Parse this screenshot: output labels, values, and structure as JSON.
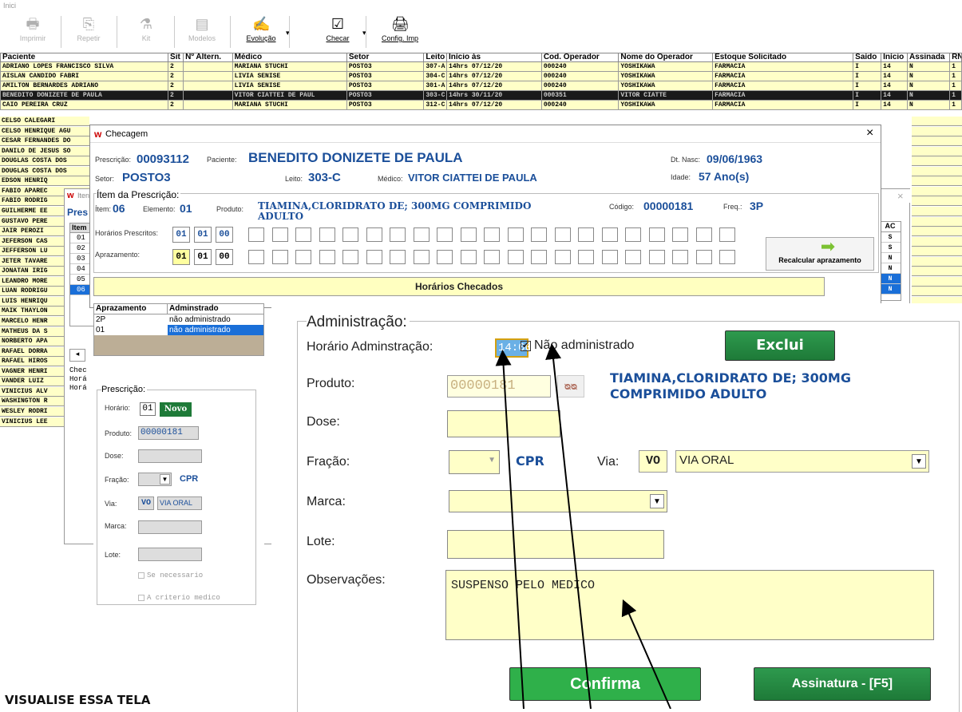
{
  "window_title": "Inici",
  "toolbar": {
    "items": [
      {
        "label": "Imprimir",
        "icon": "printer-icon",
        "enabled": false
      },
      {
        "label": "Repetir",
        "icon": "repeat-icon",
        "enabled": false
      },
      {
        "label": "Kit",
        "icon": "kit-icon",
        "enabled": false
      },
      {
        "label": "Modelos",
        "icon": "models-icon",
        "enabled": false
      },
      {
        "label": "Evolução",
        "icon": "evolution-icon",
        "enabled": true
      },
      {
        "label": "Checar",
        "icon": "check-icon",
        "enabled": true
      },
      {
        "label": "Config. Imp",
        "icon": "printer-config-icon",
        "enabled": true
      }
    ]
  },
  "grid": {
    "headers": [
      "Paciente",
      "Sit",
      "Nº Altern.",
      "Médico",
      "Setor",
      "Leito",
      "Início às",
      "Cod. Operador",
      "Nome do Operador",
      "Estoque Solicitado",
      "Saído",
      "Início",
      "Assinada",
      "RN"
    ],
    "rows": [
      [
        "ADRIANO LOPES FRANCISCO SILVA",
        "2",
        "",
        "MARIANA STUCHI",
        "POSTO3",
        "307-A",
        "14hrs 07/12/20",
        "000240",
        "YOSHIKAWA",
        "FARMACIA",
        "I",
        "14",
        "N",
        "1"
      ],
      [
        "AISLAN CANDIDO FABRI",
        "2",
        "",
        "LIVIA SENISE",
        "POSTO3",
        "304-C",
        "14hrs 07/12/20",
        "000240",
        "YOSHIKAWA",
        "FARMACIA",
        "I",
        "14",
        "N",
        "1"
      ],
      [
        "AMILTON BERNARDES ADRIANO",
        "2",
        "",
        "LIVIA SENISE",
        "POSTO3",
        "301-A",
        "14hrs 07/12/20",
        "000240",
        "YOSHIKAWA",
        "FARMACIA",
        "I",
        "14",
        "N",
        "1"
      ],
      [
        "BENEDITO DONIZETE DE PAULA",
        "2",
        "",
        "VITOR CIATTEI DE PAUL",
        "POSTO3",
        "303-C",
        "14hrs 30/11/20",
        "000351",
        "VITOR CIATTE",
        "FARMACIA",
        "I",
        "14",
        "N",
        "1"
      ],
      [
        "CAIO PEREIRA CRUZ",
        "2",
        "",
        "MARIANA STUCHI",
        "POSTO3",
        "312-C",
        "14hrs 07/12/20",
        "000240",
        "YOSHIKAWA",
        "FARMACIA",
        "I",
        "14",
        "N",
        "1"
      ]
    ],
    "left_names": [
      "CELSO CALEGARI",
      "CELSO HENRIQUE AGU",
      "CESAR FERNANDES DO",
      "DANILO DE JESUS SO",
      "DOUGLAS COSTA DOS",
      "DOUGLAS COSTA DOS",
      "EDSON HENRIQ",
      "FABIO APAREC",
      "FABIO RODRIG",
      "GUILHERME EE",
      "GUSTAVO PERE",
      "JAIR PEROZI",
      "JEFERSON CAS",
      "JEFFERSON LU",
      "JETER TAVARE",
      "JONATAN IRIG",
      "LEANDRO MORE",
      "LUAN RODRIGU",
      "LUIS HENRIQU",
      "MAIK THAYLON",
      "MARCELO HENR",
      "MATHEUS DA S",
      "NORBERTO APA",
      "RAFAEL DORRA",
      "RAFAEL HIROS",
      "VAGNER HENRI",
      "VANDER LUIZ",
      "VINICIUS ALV",
      "WASHINGTON R",
      "WESLEY RODRI",
      "VINICIUS LEE"
    ]
  },
  "checagem": {
    "title": "Checagem",
    "close": "×",
    "prescricao_label": "Prescrição:",
    "prescricao": "00093112",
    "paciente_label": "Paciente:",
    "paciente": "BENEDITO DONIZETE DE PAULA",
    "dtnasc_label": "Dt. Nasc:",
    "dtnasc": "09/06/1963",
    "setor_label": "Setor:",
    "setor": "POSTO3",
    "leito_label": "Leito:",
    "leito": "303-C",
    "medico_label": "Médico:",
    "medico": "VITOR CIATTEI DE PAULA",
    "idade_label": "Idade:",
    "idade": "57 Ano(s)",
    "item_section": "Ítem da Prescrição:",
    "item_label": "Ítem:",
    "item": "06",
    "elemento_label": "Elemento:",
    "elemento": "01",
    "produto_label": "Produto:",
    "produto_line1": "TIAMINA,CLORIDRATO DE; 300MG COMPRIMIDO",
    "produto_line2": "ADULTO",
    "codigo_label": "Código:",
    "codigo": "00000181",
    "freq_label": "Freq.:",
    "freq": "3P",
    "horarios_label": "Horários Prescritos:",
    "horarios": [
      "01",
      "01",
      "00"
    ],
    "aprazamento_label": "Aprazamento:",
    "aprazamento": [
      "01",
      "01",
      "00"
    ],
    "recalcular": "Recalcular aprazamento",
    "horarios_checados": "Horários Checados"
  },
  "back_window": {
    "title": "Iten",
    "pres": "Pres",
    "item_header": "Item",
    "items": [
      "01",
      "02",
      "03",
      "04",
      "05",
      "06"
    ],
    "chec": "Chec",
    "hora1": "Horá",
    "hora2": "Horá",
    "ac_header": "AC",
    "ac_values": [
      "S",
      "S",
      "N",
      "N",
      "N",
      "N"
    ]
  },
  "apraz_list": {
    "headers": [
      "Aprazamento",
      "Adminstrado"
    ],
    "rows": [
      [
        "2P",
        "não administrado"
      ],
      [
        "01",
        "não administrado"
      ]
    ]
  },
  "prescricao_panel": {
    "title": "Prescrição:",
    "horario_label": "Horário:",
    "horario": "01",
    "novo": "Novo",
    "produto_label": "Produto:",
    "produto": "00000181",
    "dose_label": "Dose:",
    "fracao_label": "Fração:",
    "fracao_unit": "CPR",
    "via_label": "Via:",
    "via_code": "VO",
    "via_desc": "VIA ORAL",
    "marca_label": "Marca:",
    "lote_label": "Lote:",
    "se_necessario": "Se necessario",
    "a_criterio": "A criterio medico"
  },
  "administracao": {
    "title": "Administração:",
    "horario_label": "Horário Adminstração:",
    "horario": "14:00",
    "nao_admin_label": "Não administrado",
    "exclui": "Exclui",
    "produto_label": "Produto:",
    "produto_code": "00000181",
    "produto_desc_line1": "TIAMINA,CLORIDRATO DE; 300MG",
    "produto_desc_line2": "COMPRIMIDO ADULTO",
    "dose_label": "Dose:",
    "fracao_label": "Fração:",
    "fracao_unit": "CPR",
    "via_label": "Via:",
    "via_code": "VO",
    "via_desc": "VIA ORAL",
    "marca_label": "Marca:",
    "lote_label": "Lote:",
    "obs_label": "Observações:",
    "obs_value": "SUSPENSO PELO MEDICO",
    "confirma": "Confirma",
    "assinatura": "Assinatura - [F5]"
  },
  "caption": "VISUALISE ESSA TELA"
}
